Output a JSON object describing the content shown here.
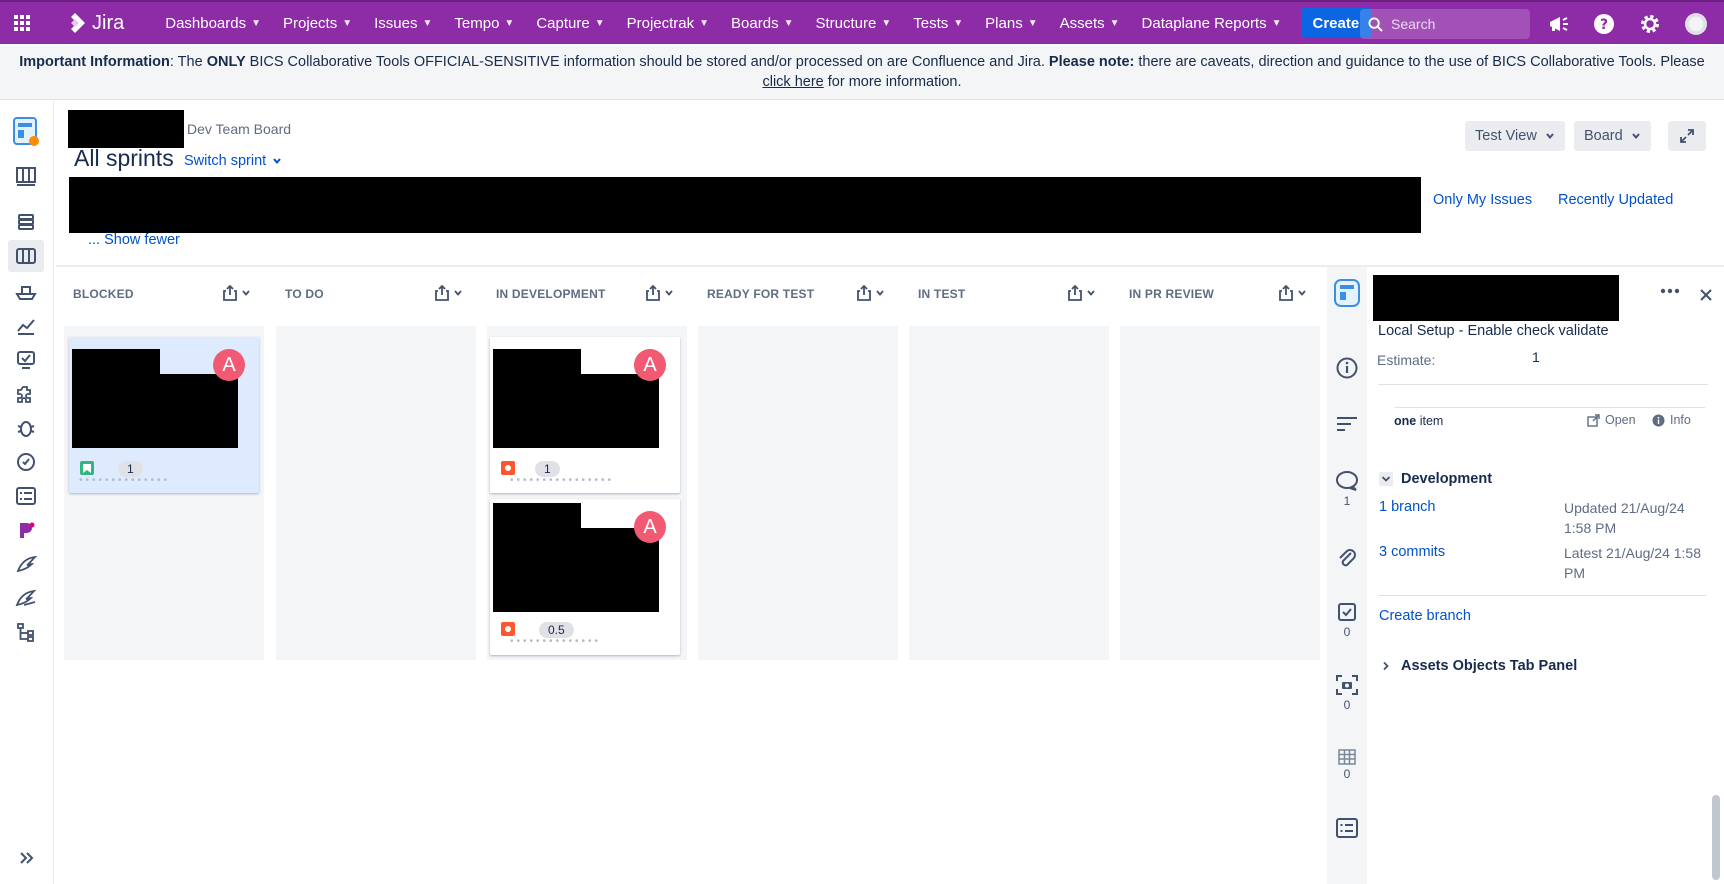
{
  "nav": {
    "logo_text": "Jira",
    "items": [
      "Dashboards",
      "Projects",
      "Issues",
      "Tempo",
      "Capture",
      "Projectrak",
      "Boards",
      "Structure",
      "Tests",
      "Plans",
      "Assets",
      "Dataplane Reports"
    ],
    "create_label": "Create",
    "search_placeholder": "Search"
  },
  "banner": {
    "part1_bold": "Important Information",
    "part2": ": The ",
    "part3_bold": "ONLY",
    "part4": " BICS Collaborative Tools OFFICIAL-SENSITIVE information should be stored and/or processed on are Confluence and Jira. ",
    "part5_bold": "Please note:",
    "part6": " there are caveats, direction and guidance to the use of BICS Collaborative Tools. Please ",
    "link": "click here",
    "part7": " for more information."
  },
  "board": {
    "name": "Dev Team Board",
    "title": "All sprints",
    "switch_sprint": "Switch sprint",
    "view_button": "Test View",
    "board_button": "Board",
    "quick_filters": [
      "Only My Issues",
      "Recently Updated"
    ],
    "show_fewer": "... Show fewer"
  },
  "columns": [
    {
      "name": "BLOCKED"
    },
    {
      "name": "TO DO"
    },
    {
      "name": "IN DEVELOPMENT"
    },
    {
      "name": "READY FOR TEST"
    },
    {
      "name": "IN TEST"
    },
    {
      "name": "IN PR REVIEW"
    }
  ],
  "cards": [
    {
      "avatar": "A",
      "estimate": "1",
      "type": "story",
      "color": "#36b37e"
    },
    {
      "avatar": "A",
      "estimate": "1",
      "type": "bug",
      "color": "#ff5630"
    },
    {
      "avatar": "A",
      "estimate": "0.5",
      "type": "bug",
      "color": "#ff5630"
    }
  ],
  "detail": {
    "summary": "Local Setup - Enable check validate",
    "estimate_label": "Estimate:",
    "estimate_value": "1",
    "items_bold": "one",
    "items_text": " item",
    "open_label": "Open",
    "info_label": "Info",
    "development_title": "Development",
    "branch_count": "1",
    "branch_label": "branch",
    "branch_updated_1": "Updated 21/Aug/24",
    "branch_updated_2": "1:58 PM",
    "commit_count": "3",
    "commit_label": "commits",
    "commit_latest_1": "Latest 21/Aug/24 1:58",
    "commit_latest_2": "PM",
    "create_branch": "Create branch",
    "assets_title": "Assets Objects Tab Panel",
    "tab_counts": {
      "comments": "1",
      "checks": "0",
      "captures": "0",
      "tests": "0"
    }
  },
  "colors": {
    "nav": "#8e2ba7",
    "accent": "#0c66e4",
    "link": "#0052cc"
  }
}
